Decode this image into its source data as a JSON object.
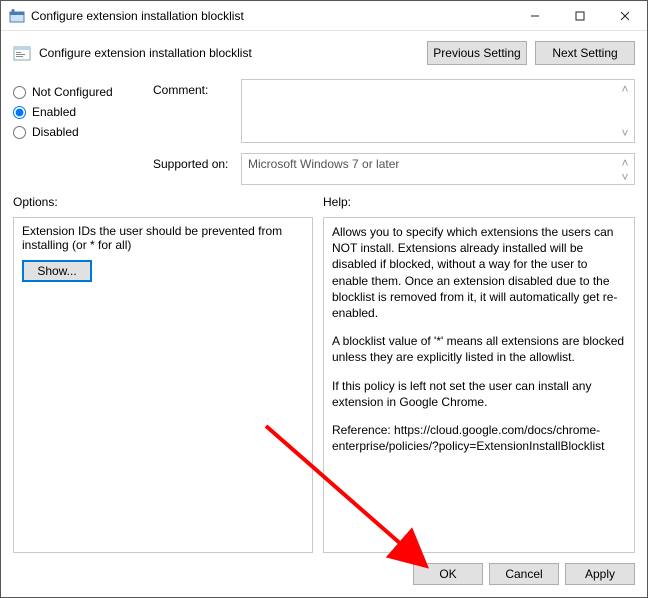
{
  "window": {
    "title": "Configure extension installation blocklist"
  },
  "toolbar": {
    "heading": "Configure extension installation blocklist",
    "previous": "Previous Setting",
    "next": "Next Setting"
  },
  "radios": {
    "not_configured": "Not Configured",
    "enabled": "Enabled",
    "disabled": "Disabled",
    "selected": "enabled"
  },
  "fields": {
    "comment_label": "Comment:",
    "comment_value": "",
    "supported_label": "Supported on:",
    "supported_value": "Microsoft Windows 7 or later"
  },
  "sections": {
    "options_label": "Options:",
    "help_label": "Help:"
  },
  "options": {
    "description": "Extension IDs the user should be prevented from installing (or * for all)",
    "show_button": "Show..."
  },
  "help": {
    "p1": "Allows you to specify which extensions the users can NOT install. Extensions already installed will be disabled if blocked, without a way for the user to enable them. Once an extension disabled due to the blocklist is removed from it, it will automatically get re-enabled.",
    "p2": "A blocklist value of '*' means all extensions are blocked unless they are explicitly listed in the allowlist.",
    "p3": "If this policy is left not set the user can install any extension in Google Chrome.",
    "p4": "Reference: https://cloud.google.com/docs/chrome-enterprise/policies/?policy=ExtensionInstallBlocklist"
  },
  "buttons": {
    "ok": "OK",
    "cancel": "Cancel",
    "apply": "Apply"
  }
}
